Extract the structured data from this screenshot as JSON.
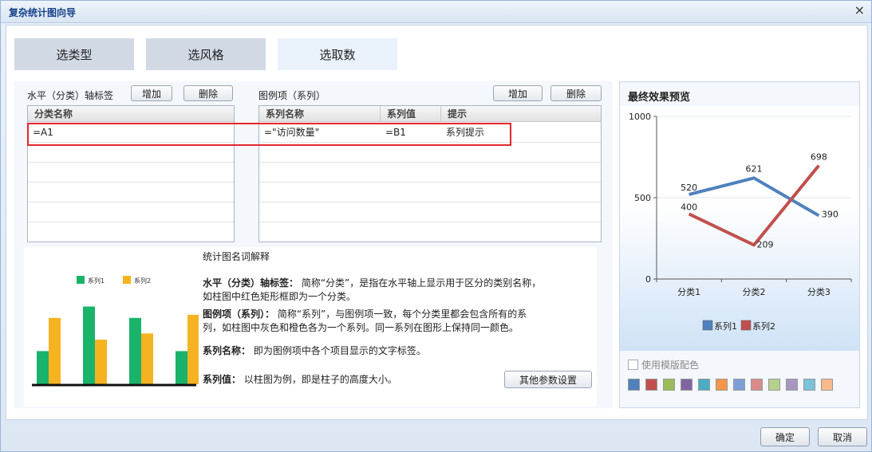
{
  "window": {
    "title": "复杂统计图向导",
    "close_glyph": "×"
  },
  "steps": [
    "选类型",
    "选风格",
    "选取数"
  ],
  "axis": {
    "label": "水平（分类）轴标签",
    "add": "增加",
    "delete": "删除",
    "header": "分类名称",
    "rows": [
      "=A1"
    ]
  },
  "legend": {
    "label": "图例项（系列）",
    "add": "增加",
    "delete": "删除",
    "headers": [
      "系列名称",
      "系列值",
      "提示"
    ],
    "rows": [
      {
        "name": "=\"访问数量\"",
        "value": "=B1",
        "tip": "系列提示"
      }
    ]
  },
  "explain": {
    "title": "统计图名词解释",
    "axis_term": "水平（分类）轴标签：",
    "axis_desc": "简称“分类”，是指在水平轴上显示用于区分的类别名称，如柱图中红色矩形框即为一个分类。",
    "legend_term": "图例项（系列）：",
    "legend_desc": "简称“系列”，与图例项一致，每个分类里都会包含所有的系列，如柱图中灰色和橙色各为一个系列。同一系列在图形上保持同一颜色。",
    "name_term": "系列名称：",
    "name_desc": "即为图例项中各个项目显示的文字标签。",
    "value_term": "系列值：",
    "value_desc": "以柱图为例，即是柱子的高度大小。",
    "more_button": "其他参数设置",
    "sample_legend": [
      "系列1",
      "系列2"
    ],
    "sample_colors": [
      "#19b36b",
      "#f5b321"
    ],
    "sample_values": {
      "series1": [
        0.32,
        0.75,
        0.64,
        0.32
      ],
      "series2": [
        0.64,
        0.43,
        0.49,
        0.67
      ]
    }
  },
  "preview": {
    "title": "最终效果预览",
    "template_label": "使用模版配色",
    "swatches": [
      "#4f81bd",
      "#c0504d",
      "#9bbb59",
      "#8064a2",
      "#4bacc6",
      "#f79646",
      "#7f9fd8",
      "#d98b8a",
      "#b6d08d",
      "#a997c2",
      "#7bc3d8",
      "#f8b98a"
    ]
  },
  "chart_data": {
    "type": "line",
    "categories": [
      "分类1",
      "分类2",
      "分类3"
    ],
    "series": [
      {
        "name": "系列1",
        "values": [
          520,
          621,
          390
        ],
        "color": "#4f81bd"
      },
      {
        "name": "系列2",
        "values": [
          400,
          209,
          698
        ],
        "color": "#c0504d"
      }
    ],
    "ylim": [
      0,
      1000
    ],
    "yticks": [
      0,
      500,
      1000
    ],
    "legend_position": "bottom"
  },
  "footer": {
    "ok": "确定",
    "cancel": "取消"
  }
}
